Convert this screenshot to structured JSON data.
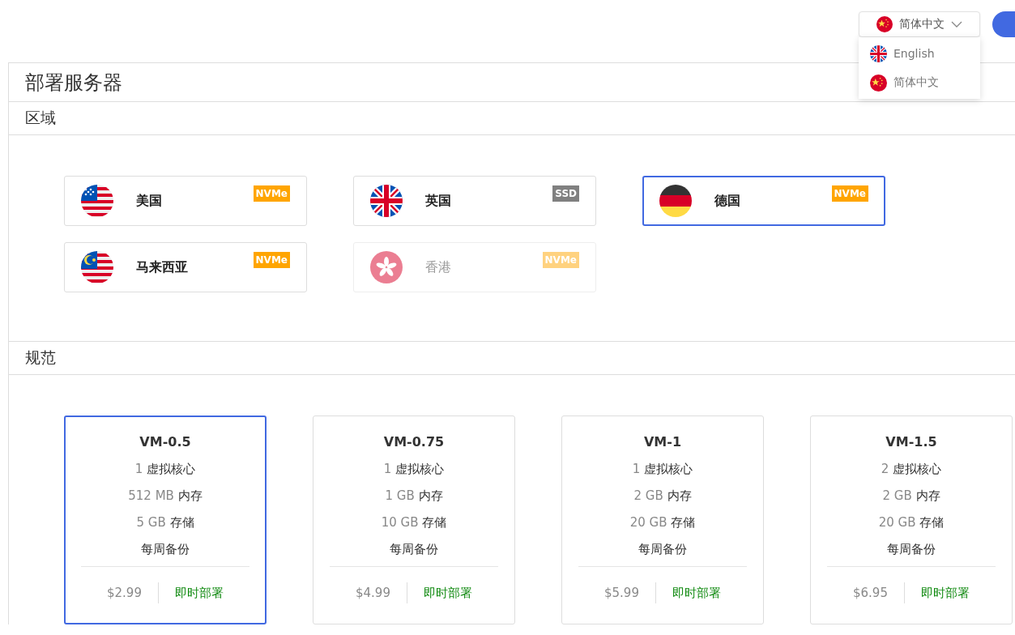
{
  "language_select": {
    "value": "简体中文",
    "kind": "cn"
  },
  "language_menu": [
    {
      "label": "English",
      "kind": "gb"
    },
    {
      "label": "简体中文",
      "kind": "cn"
    }
  ],
  "page_title": "部署服务器",
  "region_section": {
    "title": "区域",
    "regions": [
      {
        "name": "美国",
        "kind": "us",
        "badge": "NVMe",
        "color": "#ffa500",
        "selected": false,
        "disabled": false
      },
      {
        "name": "英国",
        "kind": "gb",
        "badge": "SSD",
        "color": "#808080",
        "selected": false,
        "disabled": false
      },
      {
        "name": "德国",
        "kind": "de",
        "badge": "NVMe",
        "color": "#ffa500",
        "selected": true,
        "disabled": false
      },
      {
        "name": "马来西亚",
        "kind": "my",
        "badge": "NVMe",
        "color": "#ffa500",
        "selected": false,
        "disabled": false
      },
      {
        "name": "香港",
        "kind": "hk",
        "badge": "NVMe",
        "color": "#ffd27f",
        "selected": false,
        "disabled": true
      }
    ]
  },
  "spec_section": {
    "title": "规范",
    "plans": [
      {
        "name": "VM-0.5",
        "selected": true,
        "specs": [
          {
            "value": "1",
            "label": "虚拟核心"
          },
          {
            "value": "512 MB",
            "label": "内存"
          },
          {
            "value": "5 GB",
            "label": "存储"
          },
          {
            "label": "每周备份"
          }
        ],
        "price": "$2.99",
        "action": "即时部署"
      },
      {
        "name": "VM-0.75",
        "selected": false,
        "specs": [
          {
            "value": "1",
            "label": "虚拟核心"
          },
          {
            "value": "1 GB",
            "label": "内存"
          },
          {
            "value": "10 GB",
            "label": "存储"
          },
          {
            "label": "每周备份"
          }
        ],
        "price": "$4.99",
        "action": "即时部署"
      },
      {
        "name": "VM-1",
        "selected": false,
        "specs": [
          {
            "value": "1",
            "label": "虚拟核心"
          },
          {
            "value": "2 GB",
            "label": "内存"
          },
          {
            "value": "20 GB",
            "label": "存储"
          },
          {
            "label": "每周备份"
          }
        ],
        "price": "$5.99",
        "action": "即时部署"
      },
      {
        "name": "VM-1.5",
        "selected": false,
        "specs": [
          {
            "value": "2",
            "label": "虚拟核心"
          },
          {
            "value": "2 GB",
            "label": "内存"
          },
          {
            "value": "20 GB",
            "label": "存储"
          },
          {
            "label": "每周备份"
          }
        ],
        "price": "$6.95",
        "action": "即时部署"
      }
    ]
  }
}
